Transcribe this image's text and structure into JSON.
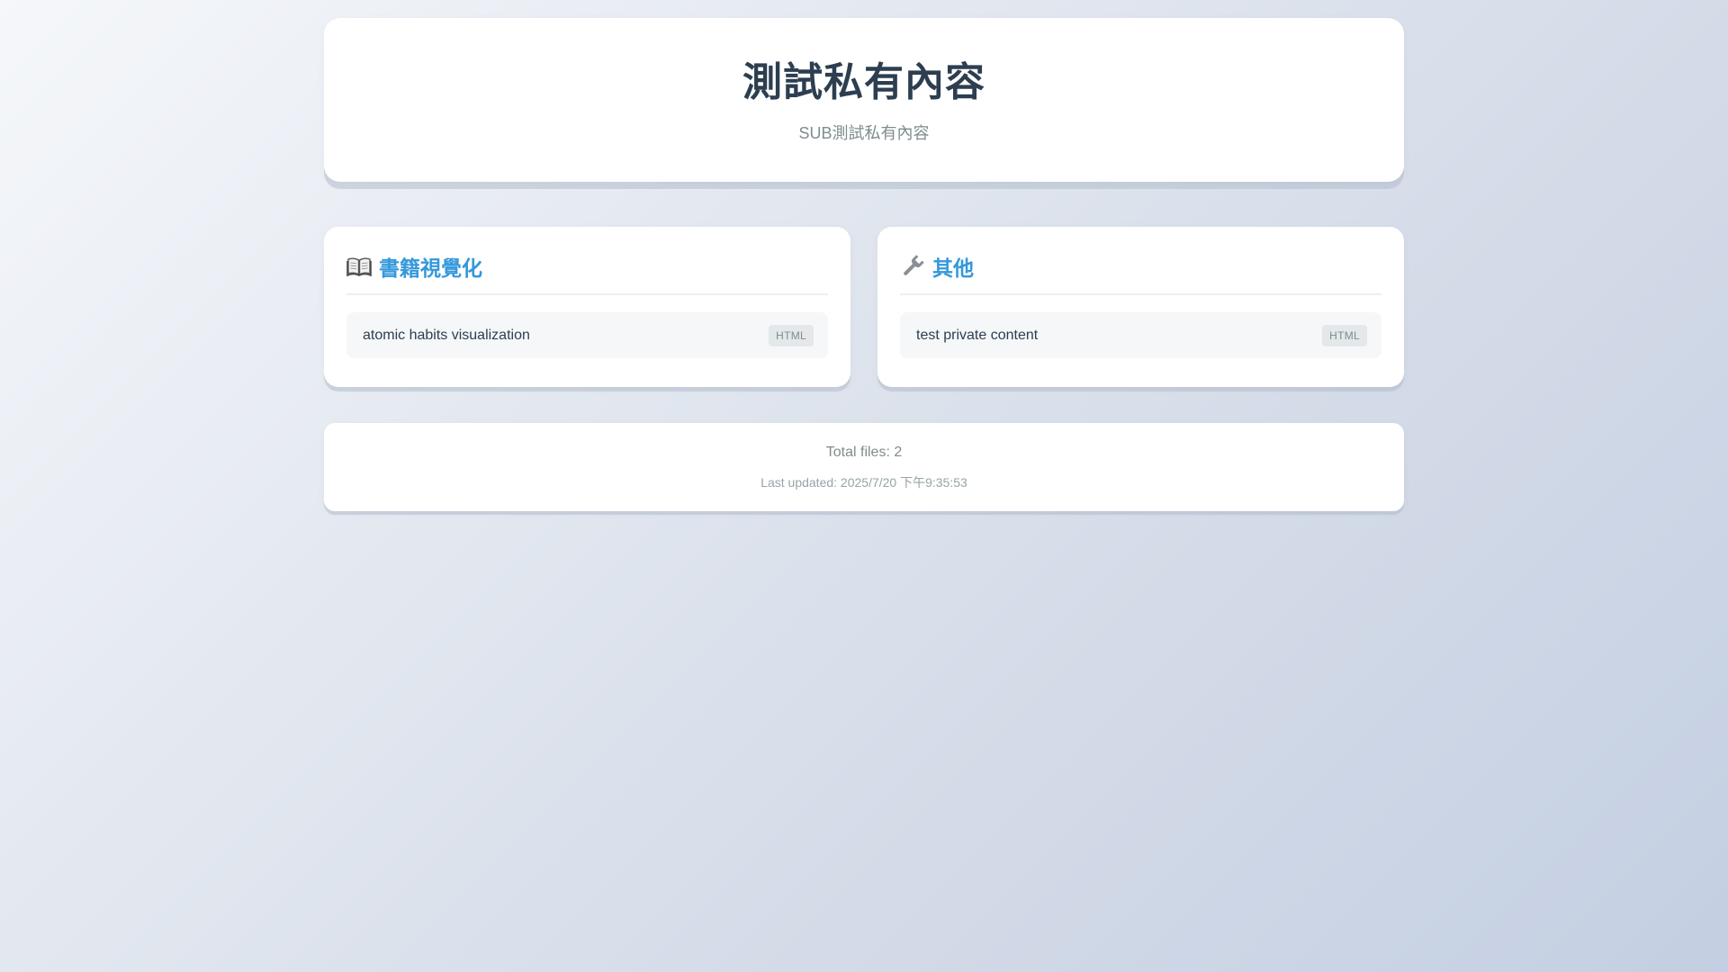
{
  "header": {
    "title": "測試私有內容",
    "subtitle": "SUB測試私有內容"
  },
  "sections": [
    {
      "icon": "open-book-icon",
      "title": "書籍視覺化",
      "files": [
        {
          "name": "atomic habits visualization",
          "type": "HTML"
        }
      ]
    },
    {
      "icon": "wrench-icon",
      "title": "其他",
      "files": [
        {
          "name": "test private content",
          "type": "HTML"
        }
      ]
    }
  ],
  "footer": {
    "total": "Total files: 2",
    "updated": "Last updated: 2025/7/20 下午9:35:53"
  },
  "colors": {
    "accent": "#3498db",
    "text": "#2c3e50",
    "muted": "#7f8c8d"
  }
}
